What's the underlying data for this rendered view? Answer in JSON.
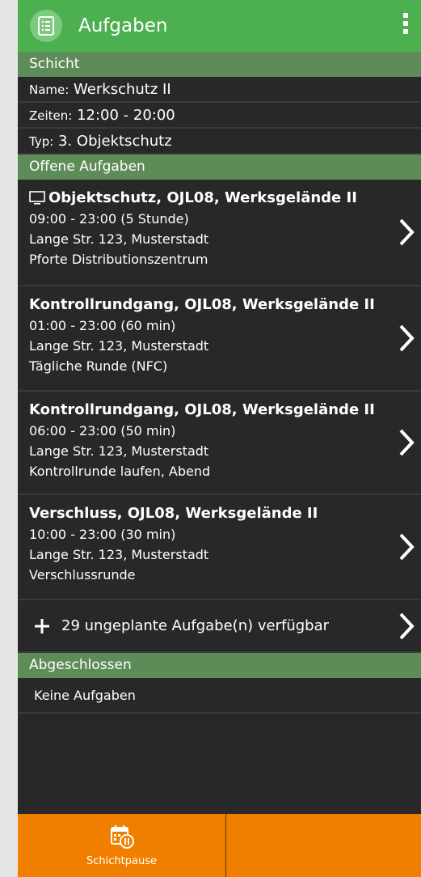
{
  "appbar": {
    "title": "Aufgaben"
  },
  "schicht": {
    "header": "Schicht",
    "name_label": "Name:",
    "name_value": "Werkschutz II",
    "zeiten_label": "Zeiten:",
    "zeiten_value": "12:00 - 20:00",
    "typ_label": "Typ:",
    "typ_value": "3. Objektschutz"
  },
  "offene": {
    "header": "Offene Aufgaben",
    "tasks": [
      {
        "title": "Objektschutz, OJL08, Werksgelände II",
        "time": "09:00 - 23:00 (5 Stunde)",
        "address": "Lange Str. 123, Musterstadt",
        "desc": "Pforte Distributionszentrum",
        "icon": "monitor-icon"
      },
      {
        "title": "Kontrollrundgang, OJL08, Werksgelände II",
        "time": "01:00 - 23:00 (60 min)",
        "address": "Lange Str. 123, Musterstadt",
        "desc": "Tägliche Runde (NFC)"
      },
      {
        "title": "Kontrollrundgang, OJL08, Werksgelände II",
        "time": "06:00 - 23:00 (50 min)",
        "address": "Lange Str. 123, Musterstadt",
        "desc": "Kontrollrunde laufen, Abend"
      },
      {
        "title": "Verschluss, OJL08, Werksgelände II",
        "time": "10:00 - 23:00 (30 min)",
        "address": "Lange Str. 123, Musterstadt",
        "desc": "Verschlussrunde"
      }
    ],
    "unplanned": "29 ungeplante Aufgabe(n) verfügbar"
  },
  "abgeschlossen": {
    "header": "Abgeschlossen",
    "empty": "Keine Aufgaben"
  },
  "bottom": {
    "pause_label": "Schichtpause"
  },
  "colors": {
    "appbar": "#4caf50",
    "section_header": "#5e8c58",
    "background": "#282828",
    "bottom_bar": "#f07f00"
  }
}
